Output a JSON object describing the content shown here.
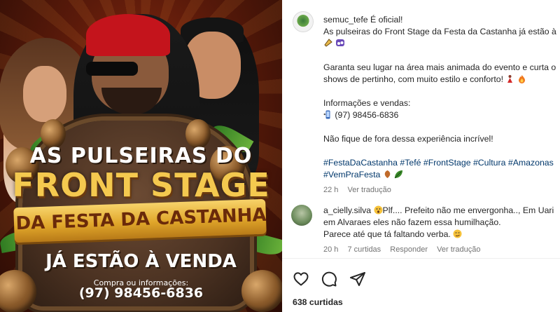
{
  "poster": {
    "line1": "AS PULSEIRAS DO",
    "line2": "FRONT STAGE",
    "line3": "DA FESTA DA CASTANHA",
    "line4": "JÁ ESTÃO À VENDA",
    "line5": "Compra ou informações:",
    "line6": "(97) 98456-6836"
  },
  "post": {
    "username": "semuc_tefe",
    "caption_l1_rest": " É oficial!",
    "caption_l2": "As pulseiras do Front Stage da Festa da Castanha já estão à",
    "caption_l4": "Garanta seu lugar na área mais animada do evento e curta o",
    "caption_l5": "shows de pertinho, com muito estilo e conforto!",
    "caption_l7": "Informações e vendas:",
    "caption_l8": "(97) 98456-6836",
    "caption_l10": "Não fique de fora dessa experiência incrível!",
    "hashtags_l1": "#FestaDaCastanha #Tefé #FrontStage #Cultura #Amazonas",
    "hashtags_l2": "#VemPraFesta",
    "time": "22 h",
    "translate": "Ver tradução"
  },
  "comment": {
    "username": "a_cielly.silva",
    "text_l1": "Plf.... Prefeito não me envergonha.., Em Uari",
    "text_l2": "em Alvaraes eles não fazem essa humilhação.",
    "text_l3": "Parece até que tá faltando verba.",
    "time": "20 h",
    "likes": "7 curtidas",
    "reply": "Responder",
    "translate": "Ver tradução"
  },
  "likes_count": "638 curtidas",
  "icons": [
    "heart-icon",
    "comment-icon",
    "share-icon"
  ]
}
